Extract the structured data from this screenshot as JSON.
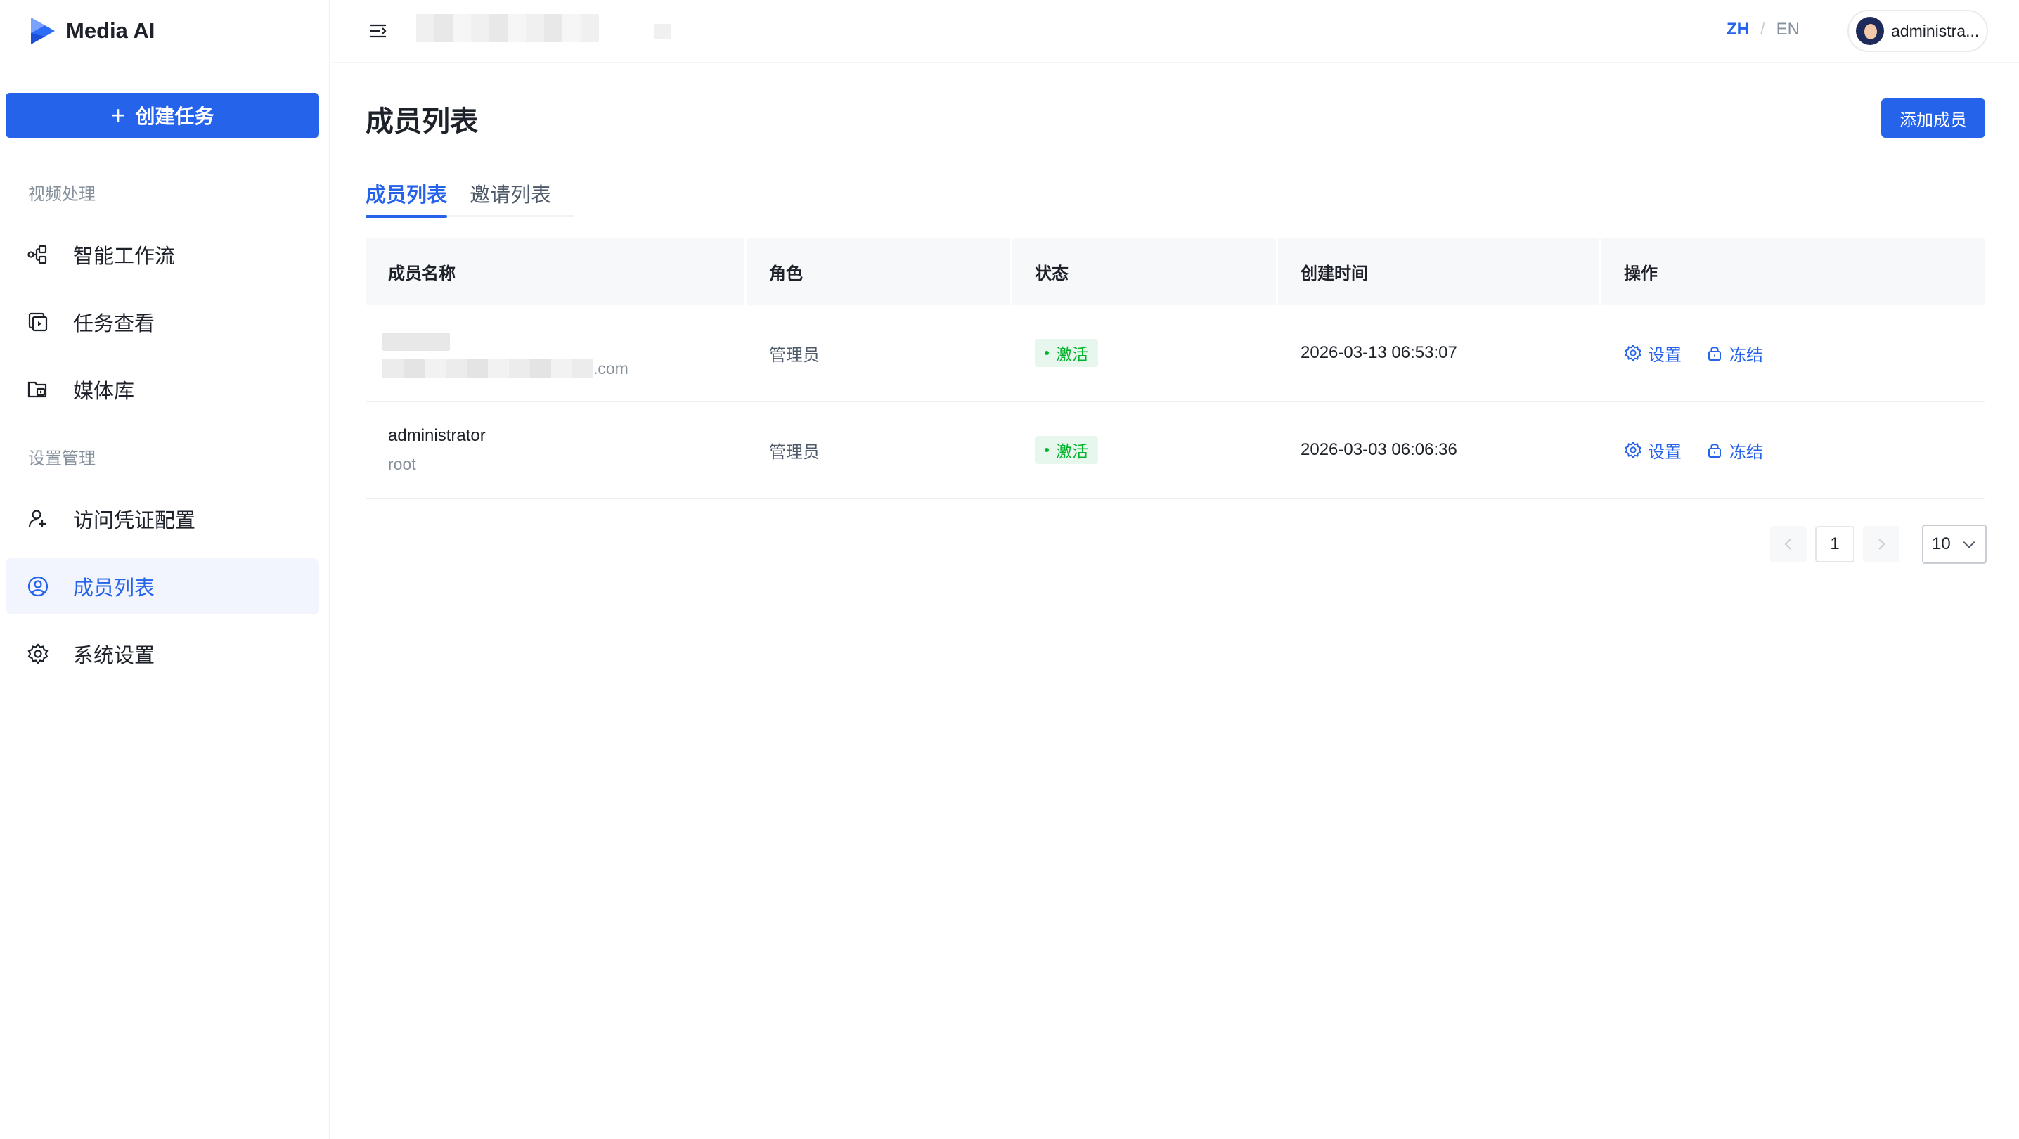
{
  "brand": {
    "name": "Media AI"
  },
  "sidebar": {
    "create_label": "创建任务",
    "sections": [
      {
        "label": "视频处理"
      },
      {
        "label": "设置管理"
      }
    ],
    "items": [
      {
        "label": "智能工作流",
        "icon": "workflow-icon"
      },
      {
        "label": "任务查看",
        "icon": "task-icon"
      },
      {
        "label": "媒体库",
        "icon": "media-library-icon"
      },
      {
        "label": "访问凭证配置",
        "icon": "credential-icon"
      },
      {
        "label": "成员列表",
        "icon": "member-icon",
        "active": true
      },
      {
        "label": "系统设置",
        "icon": "gear-icon"
      }
    ]
  },
  "header": {
    "lang_zh": "ZH",
    "lang_sep": "/",
    "lang_en": "EN",
    "user_name": "administra..."
  },
  "main": {
    "title": "成员列表",
    "add_label": "添加成员",
    "tabs": [
      {
        "label": "成员列表",
        "active": true
      },
      {
        "label": "邀请列表"
      }
    ],
    "columns": [
      "成员名称",
      "角色",
      "状态",
      "创建时间",
      "操作"
    ],
    "rows": [
      {
        "name": "",
        "email_suffix": ".com",
        "role": "管理员",
        "status": "激活",
        "created": "2026-03-13 06:53:07"
      },
      {
        "name": "administrator",
        "sub": "root",
        "role": "管理员",
        "status": "激活",
        "created": "2026-03-03 06:06:36"
      }
    ],
    "action_settings": "设置",
    "action_freeze": "冻结",
    "pagination": {
      "page": "1",
      "page_size": "10"
    }
  },
  "colors": {
    "accent": "#2563eb",
    "success": "#00b42a",
    "success_bg": "#e8f7ee"
  }
}
